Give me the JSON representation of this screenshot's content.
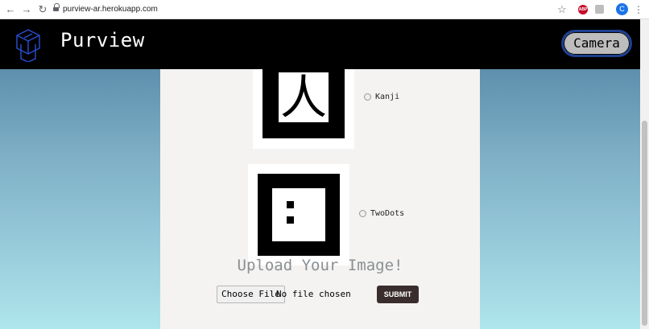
{
  "browser": {
    "url": "purview-ar.herokuapp.com",
    "back_icon": "arrow-left-icon",
    "forward_icon": "arrow-right-icon",
    "reload_icon": "reload-icon",
    "star_icon": "star-icon",
    "ext_abp_label": "ABP",
    "avatar_letter": "C",
    "avatar_color": "#1a73e8"
  },
  "header": {
    "brand": "Purview",
    "camera_label": "Camera"
  },
  "markers": [
    {
      "label": "Kanji",
      "glyph": "人"
    },
    {
      "label": "TwoDots"
    }
  ],
  "upload": {
    "title": "Upload Your Image!",
    "choose_label": "Choose File",
    "no_file_text": "No file chosen",
    "submit_label": "SUBMIT"
  },
  "colors": {
    "header_bg": "#000000",
    "camera_border": "#1c3f8f",
    "submit_bg": "#3a2d2d",
    "gradient_top": "#4c7d9e",
    "gradient_bottom": "#afe5ec"
  }
}
